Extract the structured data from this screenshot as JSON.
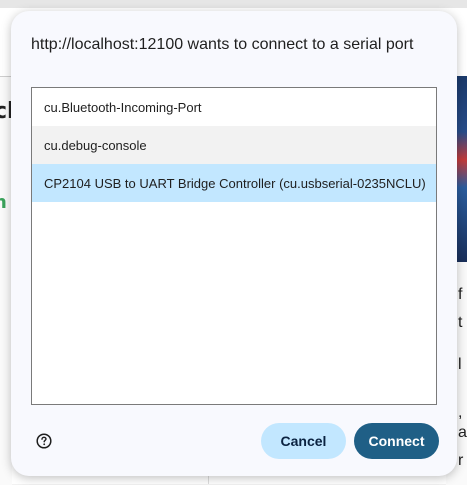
{
  "background": {
    "left_fragments": [
      "cl",
      "n"
    ],
    "right_fragments": [
      "f",
      "t",
      "l",
      ",",
      "ar",
      "r"
    ]
  },
  "dialog": {
    "title": "http://localhost:12100 wants to connect to a serial port",
    "ports": [
      {
        "label": "cu.Bluetooth-Incoming-Port",
        "state": "normal"
      },
      {
        "label": "cu.debug-console",
        "state": "hover"
      },
      {
        "label": "CP2104 USB to UART Bridge Controller (cu.usbserial-0235NCLU)",
        "state": "selected"
      }
    ],
    "help_icon": "help-circle-icon",
    "cancel_label": "Cancel",
    "connect_label": "Connect"
  },
  "colors": {
    "dialog_bg": "#f8f9fe",
    "selected_row": "#c2e7ff",
    "cancel_bg": "#c2e7ff",
    "connect_bg": "#1f5f86"
  }
}
